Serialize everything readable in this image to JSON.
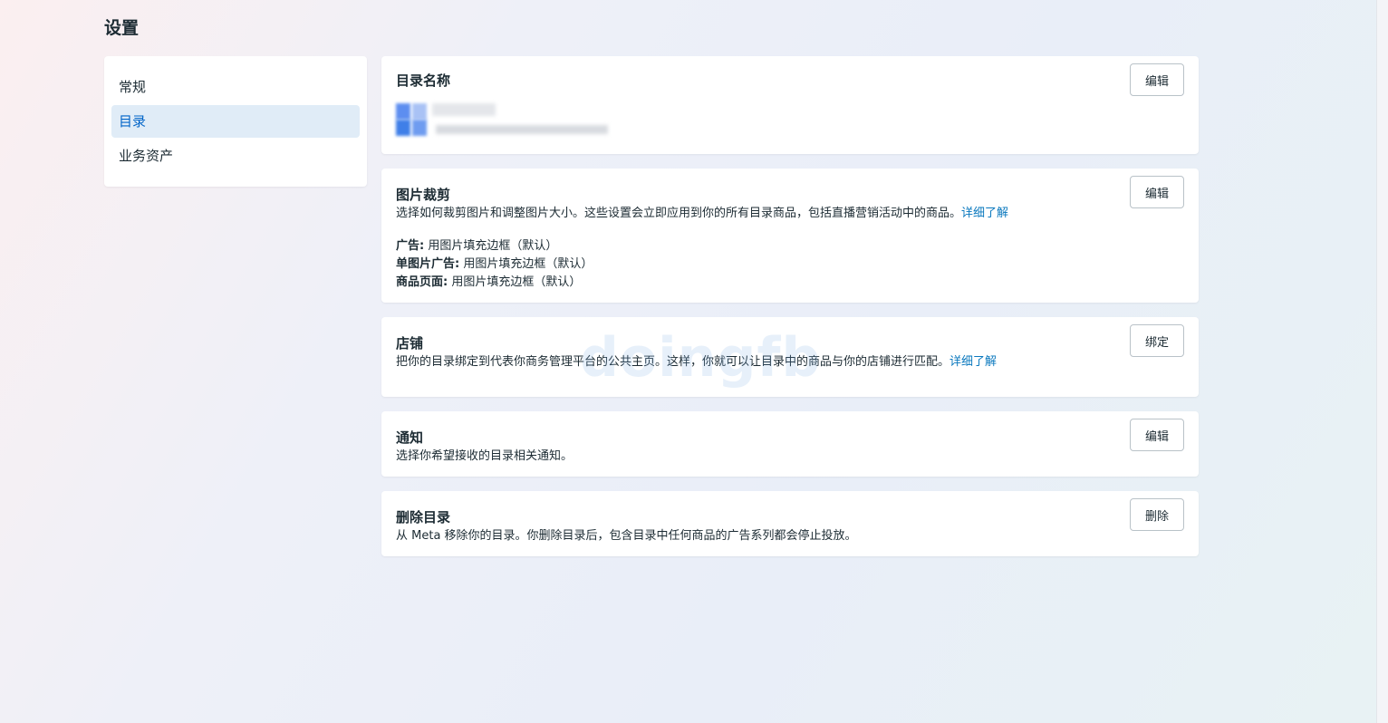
{
  "page": {
    "title": "设置"
  },
  "sidebar": {
    "items": [
      {
        "label": "常规",
        "active": false
      },
      {
        "label": "目录",
        "active": true
      },
      {
        "label": "业务资产",
        "active": false
      }
    ]
  },
  "catalog_name": {
    "title": "目录名称",
    "button_label": "编辑"
  },
  "image_crop": {
    "title": "图片裁剪",
    "description": "选择如何裁剪图片和调整图片大小。这些设置会立即应用到你的所有目录商品，包括直播营销活动中的商品。",
    "learn_more": "详细了解",
    "button_label": "编辑",
    "settings": [
      {
        "label": "广告:",
        "value": " 用图片填充边框（默认）"
      },
      {
        "label": "单图片广告:",
        "value": " 用图片填充边框（默认）"
      },
      {
        "label": "商品页面:",
        "value": " 用图片填充边框（默认）"
      }
    ]
  },
  "shop": {
    "title": "店铺",
    "description": "把你的目录绑定到代表你商务管理平台的公共主页。这样，你就可以让目录中的商品与你的店铺进行匹配。",
    "learn_more": "详细了解",
    "button_label": "绑定"
  },
  "notifications": {
    "title": "通知",
    "description": "选择你希望接收的目录相关通知。",
    "button_label": "编辑"
  },
  "delete_catalog": {
    "title": "删除目录",
    "description": "从 Meta 移除你的目录。你删除目录后，包含目录中任何商品的广告系列都会停止投放。",
    "button_label": "删除"
  },
  "watermark": {
    "text": "doingfb"
  },
  "colors": {
    "accent": "#0064c8",
    "link": "#0a78be",
    "active_bg": "#e0ecf7",
    "text": "#1c2b33"
  }
}
